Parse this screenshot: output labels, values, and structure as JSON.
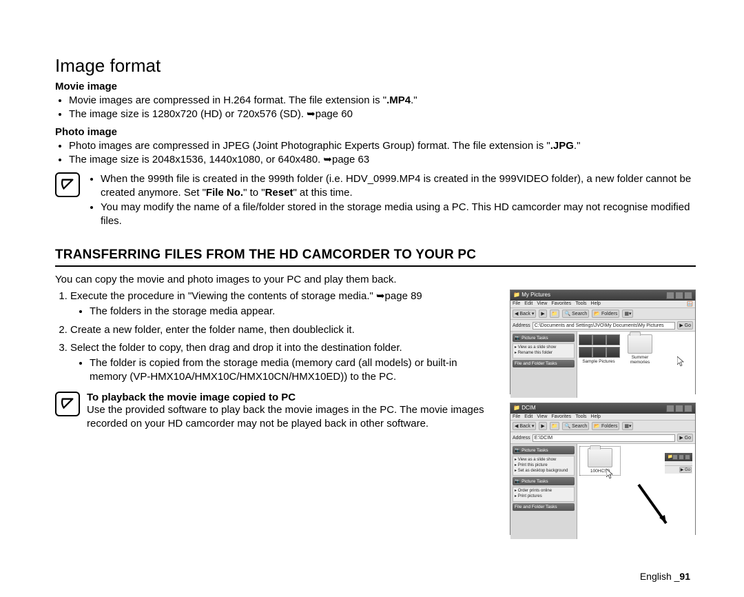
{
  "heading": "Image format",
  "movie": {
    "title": "Movie image",
    "b1_pre": "Movie images are compressed in H.264 format. The file extension is \"",
    "b1_bold": ".MP4",
    "b1_post": ".\"",
    "b2": "The image size is 1280x720 (HD) or 720x576 (SD). ➥page 60"
  },
  "photo": {
    "title": "Photo image",
    "b1_pre": "Photo images are compressed in JPEG (Joint Photographic Experts Group) format. The file extension is \"",
    "b1_bold": ".JPG",
    "b1_post": ".\"",
    "b2": "The image size is 2048x1536, 1440x1080, or 640x480. ➥page 63"
  },
  "notes": {
    "n1_pre": "When the 999th file is created in the 999th folder (i.e. HDV_0999.MP4 is created in the 999VIDEO folder), a new folder cannot be created anymore. Set \"",
    "n1_b1": "File No.",
    "n1_mid": "\" to \"",
    "n1_b2": "Reset",
    "n1_post": "\" at this time.",
    "n2": "You may modify the name of a file/folder stored in the storage media using a PC. This HD camcorder may not recognise modified files."
  },
  "h2": "TRANSFERRING FILES FROM THE HD CAMCORDER TO YOUR PC",
  "intro": "You can copy the movie and photo images to your PC and play them back.",
  "steps": {
    "s1": "Execute the procedure in \"Viewing the contents of storage media.\" ➥page 89",
    "s1sub": "The folders in the storage media appear.",
    "s2": "Create a new folder, enter the folder name, then doubleclick it.",
    "s3": "Select the folder to copy, then drag and drop it into the destination folder.",
    "s3sub": "The folder is copied from the storage media (memory card (all models) or built-in memory (VP-HMX10A/HMX10C/HMX10CN/HMX10ED)) to the PC."
  },
  "playback": {
    "title": "To playback the movie image copied to PC",
    "text": "Use the provided software to play back the movie images in the PC. The movie images recorded on your HD camcorder may not be played back in other software."
  },
  "win1": {
    "title": "My Pictures",
    "menus": [
      "File",
      "Edit",
      "View",
      "Favorites",
      "Tools",
      "Help"
    ],
    "back": "Back",
    "search": "Search",
    "folders": "Folders",
    "address_label": "Address",
    "address": "C:\\Documents and Settings\\JVO\\My Documents\\My Pictures",
    "go": "Go",
    "panel_title": "Picture Tasks",
    "panel_items": [
      "View as a slide show",
      "Rename this folder"
    ],
    "ftasks": "File and Folder Tasks",
    "folder1": "Sample Pictures",
    "folder2": "Summer memories"
  },
  "win2": {
    "title": "DCIM",
    "menus": [
      "File",
      "Edit",
      "View",
      "Favorites",
      "Tools",
      "Help"
    ],
    "back": "Back",
    "search": "Search",
    "folders": "Folders",
    "address_label": "Address",
    "address": "E:\\DCIM",
    "go": "Go",
    "panel_title": "Picture Tasks",
    "panel_items": [
      "View as a slide show",
      "Print this picture",
      "Set as desktop background"
    ],
    "panel2_title": "Picture Tasks",
    "panel2_items": [
      "Order prints online",
      "Print pictures"
    ],
    "ftasks": "File and Folder Tasks",
    "folder1": "100HCS0"
  },
  "footer": {
    "lang": "English _",
    "page": "91"
  }
}
